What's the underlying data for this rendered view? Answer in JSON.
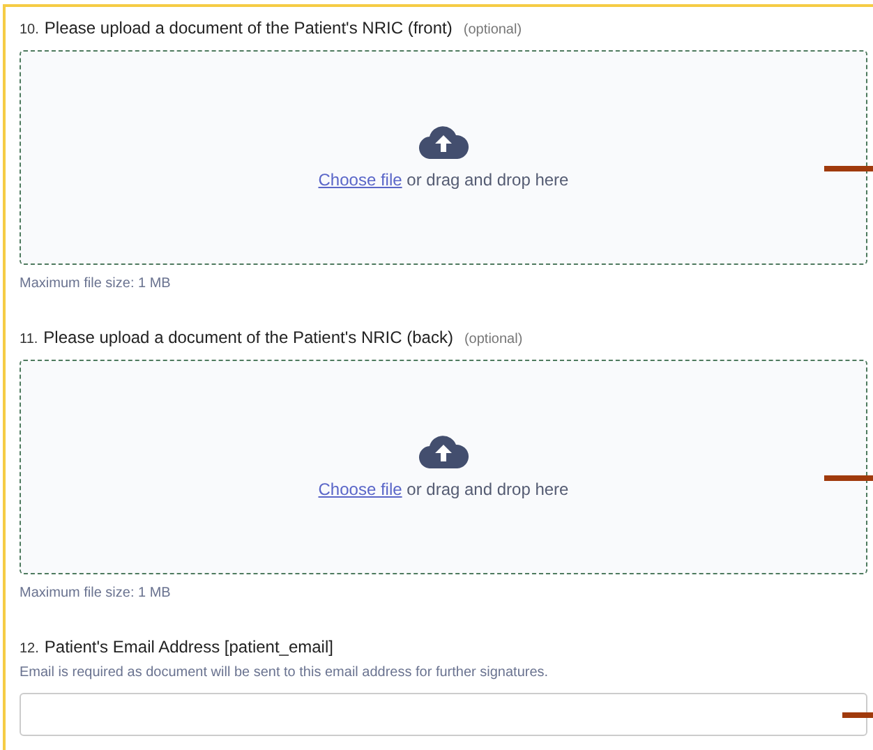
{
  "questions": [
    {
      "kind": "upload",
      "number": "10.",
      "title": "Please upload a document of the Patient's NRIC (front)",
      "optional": "(optional)",
      "link": "Choose file",
      "drop_text": "or drag and drop here",
      "note": "Maximum file size: 1 MB"
    },
    {
      "kind": "upload",
      "number": "11.",
      "title": "Please upload a document of the Patient's NRIC (back)",
      "optional": "(optional)",
      "link": "Choose file",
      "drop_text": "or drag and drop here",
      "note": "Maximum file size: 1 MB"
    },
    {
      "kind": "text",
      "number": "12.",
      "title": "Patient's Email Address [patient_email]",
      "description": "Email is required as document will be sent to this email address for further signatures."
    }
  ]
}
